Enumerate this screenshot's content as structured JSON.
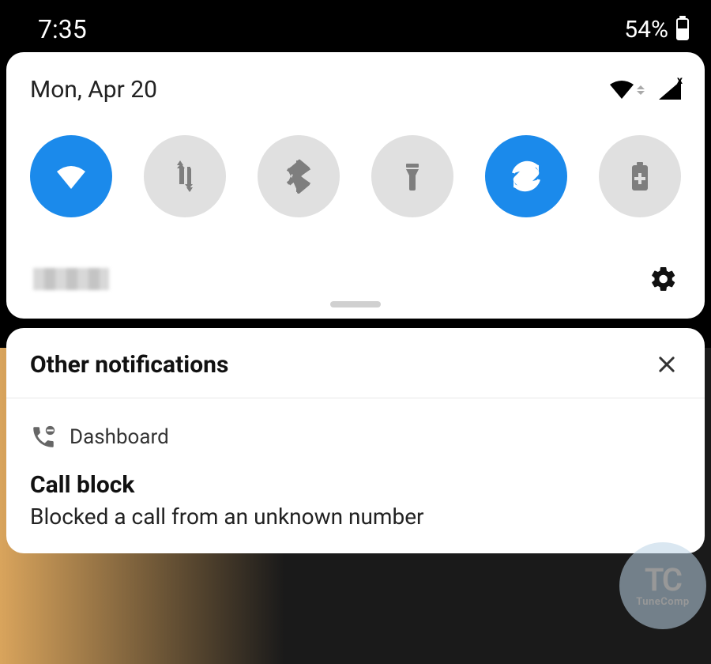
{
  "status_bar": {
    "time": "7:35",
    "battery_percent": "54%"
  },
  "quick_settings": {
    "date": "Mon, Apr 20",
    "signal_indicator": "x",
    "tiles": [
      {
        "name": "wifi",
        "active": true
      },
      {
        "name": "mobile-data",
        "active": false
      },
      {
        "name": "bluetooth",
        "active": false
      },
      {
        "name": "flashlight",
        "active": false
      },
      {
        "name": "auto-rotate",
        "active": true
      },
      {
        "name": "battery-saver",
        "active": false
      }
    ]
  },
  "notification_section": {
    "header": "Other notifications",
    "app_name": "Dashboard",
    "title": "Call block",
    "body": "Blocked a call from an unknown number"
  },
  "watermark": {
    "top": "TC",
    "bottom": "TuneComp"
  }
}
